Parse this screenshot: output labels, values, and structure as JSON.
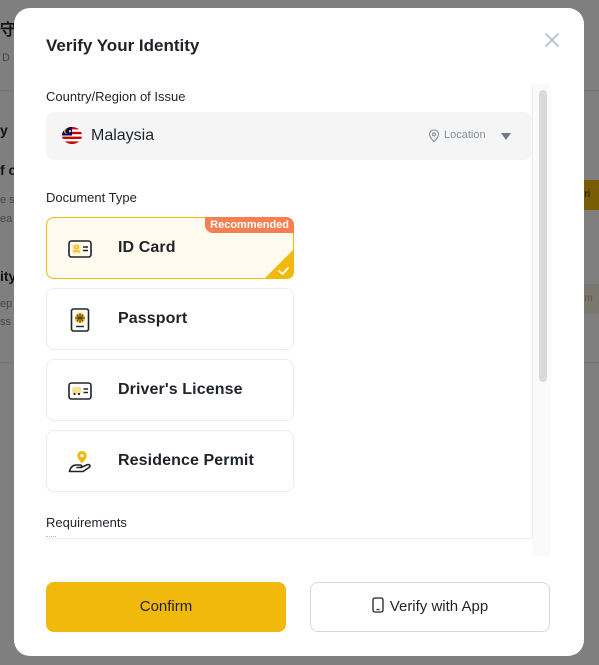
{
  "background": {
    "fragments": [
      "y",
      "f c",
      "ity",
      "ify"
    ],
    "sub_fragments": [
      "D",
      "e s",
      "ea",
      "ep",
      "ss"
    ],
    "right_btn_1": "eri",
    "right_btn_2": "om"
  },
  "modal": {
    "title": "Verify Your Identity",
    "country_section": {
      "label": "Country/Region of Issue",
      "selected_country": "Malaysia",
      "flag_icon": "malaysia-flag-icon",
      "location_label": "Location"
    },
    "document_section": {
      "label": "Document Type",
      "options": [
        {
          "label": "ID Card",
          "icon": "id-card-icon",
          "selected": true,
          "badge": "Recommended"
        },
        {
          "label": "Passport",
          "icon": "passport-icon",
          "selected": false
        },
        {
          "label": "Driver's License",
          "icon": "drivers-license-icon",
          "selected": false
        },
        {
          "label": "Residence Permit",
          "icon": "residence-permit-icon",
          "selected": false
        }
      ]
    },
    "requirements_label": "Requirements",
    "buttons": {
      "confirm": "Confirm",
      "verify_app": "Verify with App"
    }
  },
  "colors": {
    "accent": "#f0b90b",
    "badge": "#f57f50",
    "text": "#1e2329",
    "muted": "#848e9c"
  }
}
